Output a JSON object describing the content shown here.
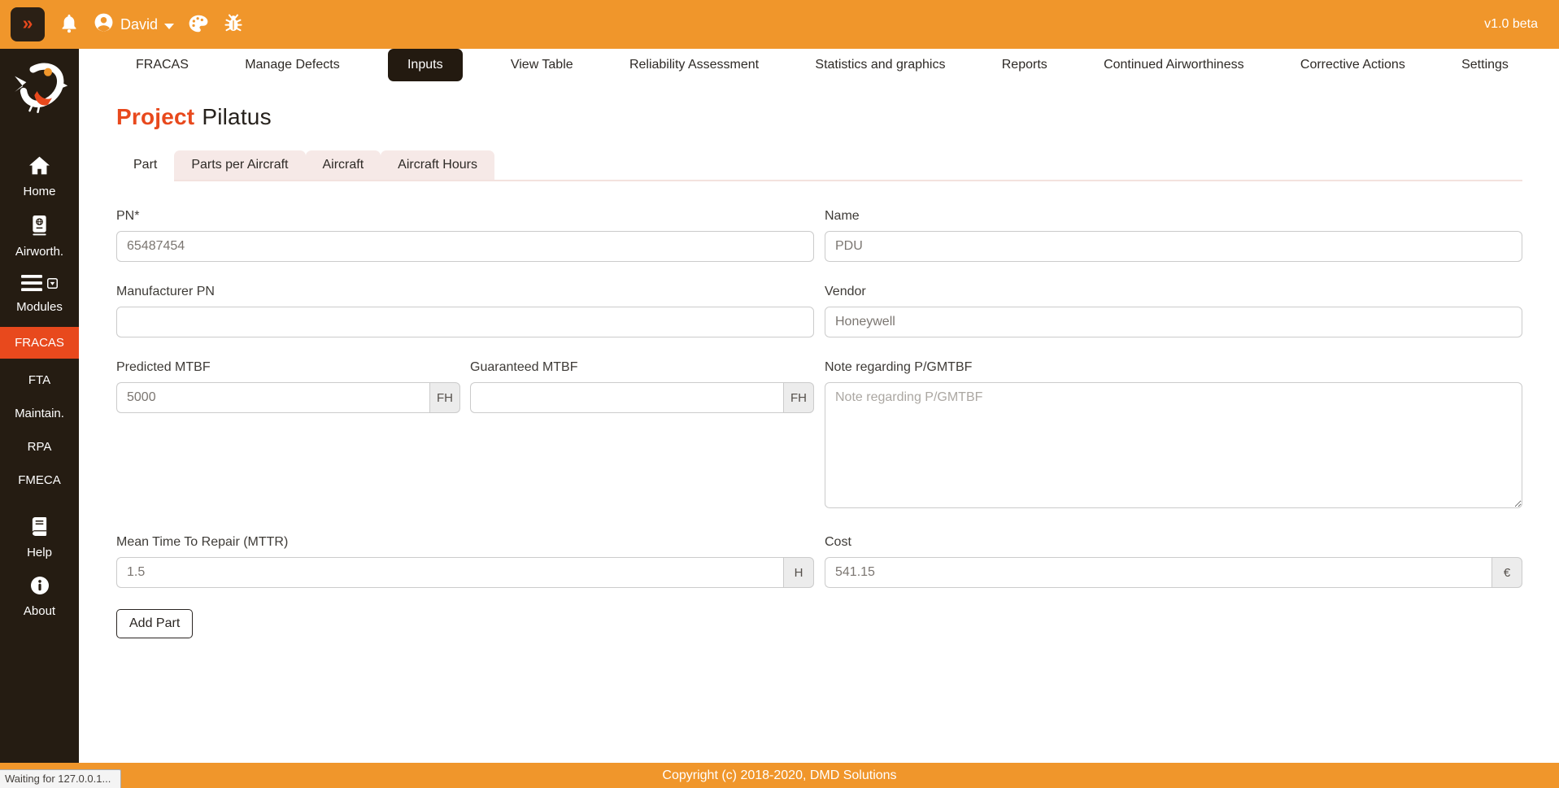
{
  "colors": {
    "topbar_orange": "#F0962B",
    "sidebar_dark": "#251C12",
    "accent_red": "#E8491D"
  },
  "topbar": {
    "collapse_label": "»",
    "username": "David",
    "version": "v1.0 beta"
  },
  "nav": {
    "items": [
      "FRACAS",
      "Manage Defects",
      "Inputs",
      "View Table",
      "Reliability Assessment",
      "Statistics and graphics",
      "Reports",
      "Continued Airworthiness",
      "Corrective Actions",
      "Settings"
    ],
    "active": "Inputs"
  },
  "sidebar": {
    "home": "Home",
    "airworth": "Airworth.",
    "modules": "Modules",
    "fracas": "FRACAS",
    "fta": "FTA",
    "maintain": "Maintain.",
    "rpa": "RPA",
    "fmeca": "FMECA",
    "help": "Help",
    "about": "About"
  },
  "page": {
    "title_prefix": "Project",
    "title_value": "Pilatus"
  },
  "tabs": {
    "part": "Part",
    "parts_per_aircraft": "Parts per Aircraft",
    "aircraft": "Aircraft",
    "aircraft_hours": "Aircraft Hours",
    "active": "Part"
  },
  "form": {
    "pn": {
      "label": "PN*",
      "value": "65487454"
    },
    "name": {
      "label": "Name",
      "value": "PDU"
    },
    "manufacturer_pn": {
      "label": "Manufacturer PN",
      "value": ""
    },
    "vendor": {
      "label": "Vendor",
      "value": "Honeywell"
    },
    "predicted_mtbf": {
      "label": "Predicted MTBF",
      "value": "5000",
      "addon": "FH"
    },
    "guaranteed_mtbf": {
      "label": "Guaranteed MTBF",
      "value": "",
      "addon": "FH"
    },
    "note": {
      "label": "Note regarding P/GMTBF",
      "placeholder": "Note regarding P/GMTBF",
      "value": ""
    },
    "mttr": {
      "label": "Mean Time To Repair (MTTR)",
      "value": "1.5",
      "addon": "H"
    },
    "cost": {
      "label": "Cost",
      "value": "541.15",
      "addon": "€"
    },
    "submit_label": "Add Part"
  },
  "footer": {
    "copyright": "Copyright (c) 2018-2020, DMD Solutions"
  },
  "statusbar": {
    "text": "Waiting for 127.0.0.1..."
  }
}
